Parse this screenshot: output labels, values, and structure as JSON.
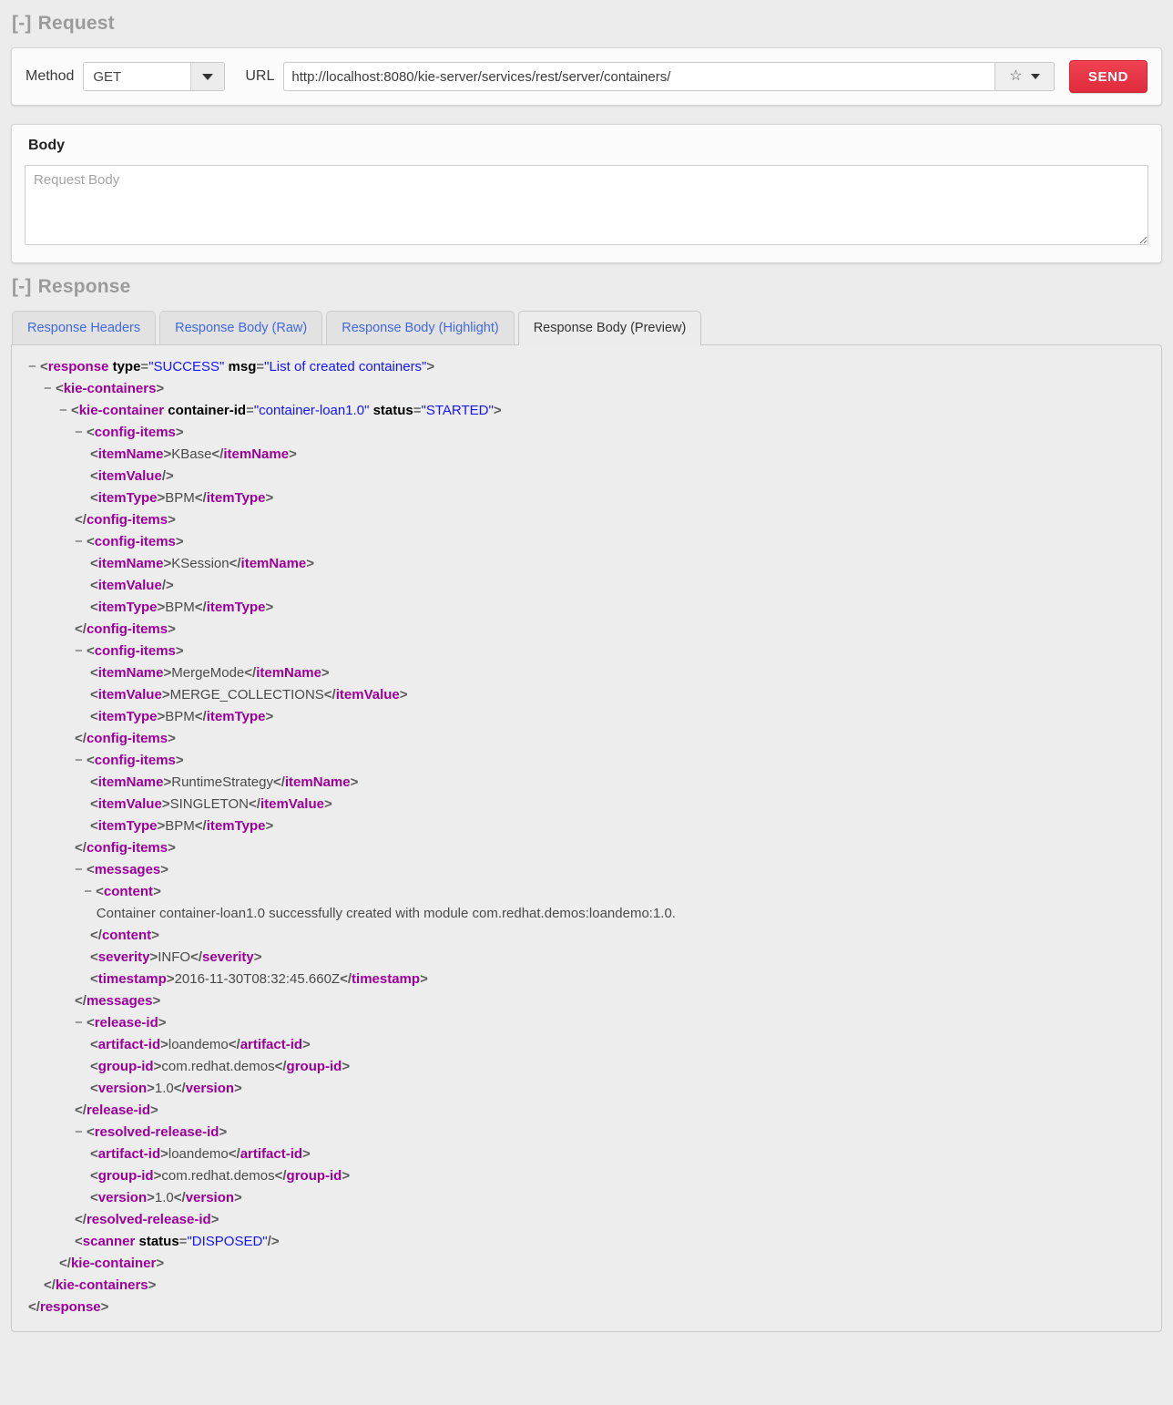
{
  "request": {
    "heading": "Request",
    "toggle": "[-]",
    "method_label": "Method",
    "method_value": "GET",
    "method_options": [
      "GET"
    ],
    "url_label": "URL",
    "url_value": "http://localhost:8080/kie-server/services/rest/server/containers/",
    "url_placeholder": "URL",
    "star_icon": "☆",
    "chevron_icon": "chevron-down-icon",
    "send_label": "SEND",
    "send_color": "#e02b3c"
  },
  "body": {
    "title": "Body",
    "placeholder": "Request Body",
    "value": ""
  },
  "response": {
    "heading": "Response",
    "toggle": "[-]",
    "tabs": [
      {
        "label": "Response Headers",
        "active": false
      },
      {
        "label": "Response Body (Raw)",
        "active": false
      },
      {
        "label": "Response Body (Highlight)",
        "active": false
      },
      {
        "label": "Response Body (Preview)",
        "active": true
      }
    ],
    "link_color": "#4169e1"
  },
  "xml": {
    "colors": {
      "tag": "#9b009b",
      "attribute_name": "#000000",
      "attribute_value": "#1414ff",
      "text": "#4a4a4a",
      "background": "#ededed"
    },
    "lines": [
      {
        "indent": 0,
        "marker": "−",
        "html": "<span class=\"br\">&lt;</span><span class=\"tg\">response</span> <span class=\"at\">type</span><span class=\"eq\">=</span><span class=\"av\">\"SUCCESS\"</span> <span class=\"at\">msg</span><span class=\"eq\">=</span><span class=\"av\">\"List of created containers\"</span><span class=\"br\">&gt;</span>"
      },
      {
        "indent": 1,
        "marker": "−",
        "html": "<span class=\"br\">&lt;</span><span class=\"tg\">kie-containers</span><span class=\"br\">&gt;</span>"
      },
      {
        "indent": 2,
        "marker": "−",
        "html": "<span class=\"br\">&lt;</span><span class=\"tg\">kie-container</span> <span class=\"at\">container-id</span><span class=\"eq\">=</span><span class=\"av\">\"container-loan1.0\"</span> <span class=\"at\">status</span><span class=\"eq\">=</span><span class=\"av\">\"STARTED\"</span><span class=\"br\">&gt;</span>"
      },
      {
        "indent": 3,
        "marker": "−",
        "html": "<span class=\"br\">&lt;</span><span class=\"tg\">config-items</span><span class=\"br\">&gt;</span>"
      },
      {
        "indent": 4,
        "marker": "",
        "html": "<span class=\"br\">&lt;</span><span class=\"tg\">itemName</span><span class=\"br\">&gt;</span><span class=\"txt\">KBase</span><span class=\"br\">&lt;/</span><span class=\"tg\">itemName</span><span class=\"br\">&gt;</span>"
      },
      {
        "indent": 4,
        "marker": "",
        "html": "<span class=\"br\">&lt;</span><span class=\"tg\">itemValue</span><span class=\"br\">/&gt;</span>"
      },
      {
        "indent": 4,
        "marker": "",
        "html": "<span class=\"br\">&lt;</span><span class=\"tg\">itemType</span><span class=\"br\">&gt;</span><span class=\"txt\">BPM</span><span class=\"br\">&lt;/</span><span class=\"tg\">itemType</span><span class=\"br\">&gt;</span>"
      },
      {
        "indent": 3,
        "marker": "",
        "html": "<span class=\"br\">&lt;/</span><span class=\"tg\">config-items</span><span class=\"br\">&gt;</span>"
      },
      {
        "indent": 3,
        "marker": "−",
        "html": "<span class=\"br\">&lt;</span><span class=\"tg\">config-items</span><span class=\"br\">&gt;</span>"
      },
      {
        "indent": 4,
        "marker": "",
        "html": "<span class=\"br\">&lt;</span><span class=\"tg\">itemName</span><span class=\"br\">&gt;</span><span class=\"txt\">KSession</span><span class=\"br\">&lt;/</span><span class=\"tg\">itemName</span><span class=\"br\">&gt;</span>"
      },
      {
        "indent": 4,
        "marker": "",
        "html": "<span class=\"br\">&lt;</span><span class=\"tg\">itemValue</span><span class=\"br\">/&gt;</span>"
      },
      {
        "indent": 4,
        "marker": "",
        "html": "<span class=\"br\">&lt;</span><span class=\"tg\">itemType</span><span class=\"br\">&gt;</span><span class=\"txt\">BPM</span><span class=\"br\">&lt;/</span><span class=\"tg\">itemType</span><span class=\"br\">&gt;</span>"
      },
      {
        "indent": 3,
        "marker": "",
        "html": "<span class=\"br\">&lt;/</span><span class=\"tg\">config-items</span><span class=\"br\">&gt;</span>"
      },
      {
        "indent": 3,
        "marker": "−",
        "html": "<span class=\"br\">&lt;</span><span class=\"tg\">config-items</span><span class=\"br\">&gt;</span>"
      },
      {
        "indent": 4,
        "marker": "",
        "html": "<span class=\"br\">&lt;</span><span class=\"tg\">itemName</span><span class=\"br\">&gt;</span><span class=\"txt\">MergeMode</span><span class=\"br\">&lt;/</span><span class=\"tg\">itemName</span><span class=\"br\">&gt;</span>"
      },
      {
        "indent": 4,
        "marker": "",
        "html": "<span class=\"br\">&lt;</span><span class=\"tg\">itemValue</span><span class=\"br\">&gt;</span><span class=\"txt\">MERGE_COLLECTIONS</span><span class=\"br\">&lt;/</span><span class=\"tg\">itemValue</span><span class=\"br\">&gt;</span>"
      },
      {
        "indent": 4,
        "marker": "",
        "html": "<span class=\"br\">&lt;</span><span class=\"tg\">itemType</span><span class=\"br\">&gt;</span><span class=\"txt\">BPM</span><span class=\"br\">&lt;/</span><span class=\"tg\">itemType</span><span class=\"br\">&gt;</span>"
      },
      {
        "indent": 3,
        "marker": "",
        "html": "<span class=\"br\">&lt;/</span><span class=\"tg\">config-items</span><span class=\"br\">&gt;</span>"
      },
      {
        "indent": 3,
        "marker": "−",
        "html": "<span class=\"br\">&lt;</span><span class=\"tg\">config-items</span><span class=\"br\">&gt;</span>"
      },
      {
        "indent": 4,
        "marker": "",
        "html": "<span class=\"br\">&lt;</span><span class=\"tg\">itemName</span><span class=\"br\">&gt;</span><span class=\"txt\">RuntimeStrategy</span><span class=\"br\">&lt;/</span><span class=\"tg\">itemName</span><span class=\"br\">&gt;</span>"
      },
      {
        "indent": 4,
        "marker": "",
        "html": "<span class=\"br\">&lt;</span><span class=\"tg\">itemValue</span><span class=\"br\">&gt;</span><span class=\"txt\">SINGLETON</span><span class=\"br\">&lt;/</span><span class=\"tg\">itemValue</span><span class=\"br\">&gt;</span>"
      },
      {
        "indent": 4,
        "marker": "",
        "html": "<span class=\"br\">&lt;</span><span class=\"tg\">itemType</span><span class=\"br\">&gt;</span><span class=\"txt\">BPM</span><span class=\"br\">&lt;/</span><span class=\"tg\">itemType</span><span class=\"br\">&gt;</span>"
      },
      {
        "indent": 3,
        "marker": "",
        "html": "<span class=\"br\">&lt;/</span><span class=\"tg\">config-items</span><span class=\"br\">&gt;</span>"
      },
      {
        "indent": 3,
        "marker": "−",
        "html": "<span class=\"br\">&lt;</span><span class=\"tg\">messages</span><span class=\"br\">&gt;</span>"
      },
      {
        "indent": 3.6,
        "marker": "−",
        "html": "<span class=\"br\">&lt;</span><span class=\"tg\">content</span><span class=\"br\">&gt;</span>"
      },
      {
        "indent": 4.4,
        "marker": "",
        "html": "<span class=\"txt\">Container container-loan1.0 successfully created with module com.redhat.demos:loandemo:1.0.</span>"
      },
      {
        "indent": 4,
        "marker": "",
        "html": "<span class=\"br\">&lt;/</span><span class=\"tg\">content</span><span class=\"br\">&gt;</span>"
      },
      {
        "indent": 4,
        "marker": "",
        "html": "<span class=\"br\">&lt;</span><span class=\"tg\">severity</span><span class=\"br\">&gt;</span><span class=\"txt\">INFO</span><span class=\"br\">&lt;/</span><span class=\"tg\">severity</span><span class=\"br\">&gt;</span>"
      },
      {
        "indent": 4,
        "marker": "",
        "html": "<span class=\"br\">&lt;</span><span class=\"tg\">timestamp</span><span class=\"br\">&gt;</span><span class=\"txt\">2016-11-30T08:32:45.660Z</span><span class=\"br\">&lt;/</span><span class=\"tg\">timestamp</span><span class=\"br\">&gt;</span>"
      },
      {
        "indent": 3,
        "marker": "",
        "html": "<span class=\"br\">&lt;/</span><span class=\"tg\">messages</span><span class=\"br\">&gt;</span>"
      },
      {
        "indent": 3,
        "marker": "−",
        "html": "<span class=\"br\">&lt;</span><span class=\"tg\">release-id</span><span class=\"br\">&gt;</span>"
      },
      {
        "indent": 4,
        "marker": "",
        "html": "<span class=\"br\">&lt;</span><span class=\"tg\">artifact-id</span><span class=\"br\">&gt;</span><span class=\"txt\">loandemo</span><span class=\"br\">&lt;/</span><span class=\"tg\">artifact-id</span><span class=\"br\">&gt;</span>"
      },
      {
        "indent": 4,
        "marker": "",
        "html": "<span class=\"br\">&lt;</span><span class=\"tg\">group-id</span><span class=\"br\">&gt;</span><span class=\"txt\">com.redhat.demos</span><span class=\"br\">&lt;/</span><span class=\"tg\">group-id</span><span class=\"br\">&gt;</span>"
      },
      {
        "indent": 4,
        "marker": "",
        "html": "<span class=\"br\">&lt;</span><span class=\"tg\">version</span><span class=\"br\">&gt;</span><span class=\"txt\">1.0</span><span class=\"br\">&lt;/</span><span class=\"tg\">version</span><span class=\"br\">&gt;</span>"
      },
      {
        "indent": 3,
        "marker": "",
        "html": "<span class=\"br\">&lt;/</span><span class=\"tg\">release-id</span><span class=\"br\">&gt;</span>"
      },
      {
        "indent": 3,
        "marker": "−",
        "html": "<span class=\"br\">&lt;</span><span class=\"tg\">resolved-release-id</span><span class=\"br\">&gt;</span>"
      },
      {
        "indent": 4,
        "marker": "",
        "html": "<span class=\"br\">&lt;</span><span class=\"tg\">artifact-id</span><span class=\"br\">&gt;</span><span class=\"txt\">loandemo</span><span class=\"br\">&lt;/</span><span class=\"tg\">artifact-id</span><span class=\"br\">&gt;</span>"
      },
      {
        "indent": 4,
        "marker": "",
        "html": "<span class=\"br\">&lt;</span><span class=\"tg\">group-id</span><span class=\"br\">&gt;</span><span class=\"txt\">com.redhat.demos</span><span class=\"br\">&lt;/</span><span class=\"tg\">group-id</span><span class=\"br\">&gt;</span>"
      },
      {
        "indent": 4,
        "marker": "",
        "html": "<span class=\"br\">&lt;</span><span class=\"tg\">version</span><span class=\"br\">&gt;</span><span class=\"txt\">1.0</span><span class=\"br\">&lt;/</span><span class=\"tg\">version</span><span class=\"br\">&gt;</span>"
      },
      {
        "indent": 3,
        "marker": "",
        "html": "<span class=\"br\">&lt;/</span><span class=\"tg\">resolved-release-id</span><span class=\"br\">&gt;</span>"
      },
      {
        "indent": 3,
        "marker": "",
        "html": "<span class=\"br\">&lt;</span><span class=\"tg\">scanner</span> <span class=\"at\">status</span><span class=\"eq\">=</span><span class=\"av\">\"DISPOSED\"</span><span class=\"br\">/&gt;</span>"
      },
      {
        "indent": 2,
        "marker": "",
        "html": "<span class=\"br\">&lt;/</span><span class=\"tg\">kie-container</span><span class=\"br\">&gt;</span>"
      },
      {
        "indent": 1,
        "marker": "",
        "html": "<span class=\"br\">&lt;/</span><span class=\"tg\">kie-containers</span><span class=\"br\">&gt;</span>"
      },
      {
        "indent": 0,
        "marker": "",
        "html": "<span class=\"br\">&lt;/</span><span class=\"tg\">response</span><span class=\"br\">&gt;</span>"
      }
    ]
  }
}
